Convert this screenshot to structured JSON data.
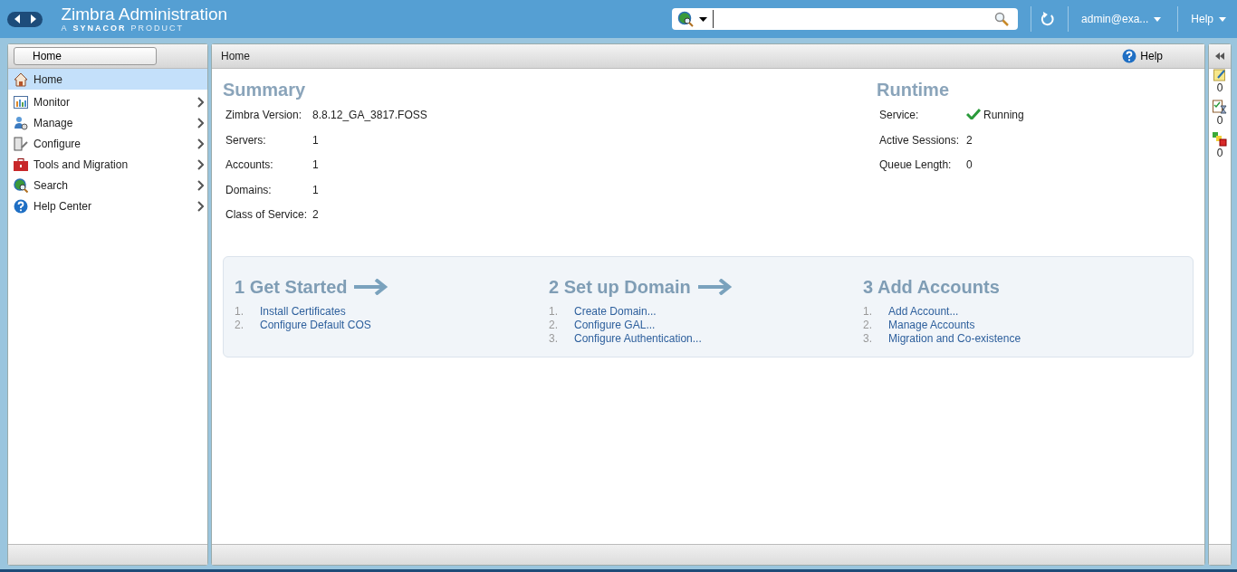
{
  "header": {
    "title": "Zimbra Administration",
    "subtitle_prefix": "A",
    "subtitle_brand": "SYNACOR",
    "subtitle_suffix": "PRODUCT",
    "user": "admin@exa...",
    "help": "Help"
  },
  "sidebar": {
    "breadcrumb": "Home",
    "items": [
      {
        "label": "Home",
        "kind": "home",
        "selected": true,
        "expandable": false
      },
      {
        "label": "Monitor",
        "kind": "monitor",
        "selected": false,
        "expandable": true
      },
      {
        "label": "Manage",
        "kind": "manage",
        "selected": false,
        "expandable": true
      },
      {
        "label": "Configure",
        "kind": "configure",
        "selected": false,
        "expandable": true
      },
      {
        "label": "Tools and Migration",
        "kind": "tools",
        "selected": false,
        "expandable": true
      },
      {
        "label": "Search",
        "kind": "search",
        "selected": false,
        "expandable": true
      },
      {
        "label": "Help Center",
        "kind": "help",
        "selected": false,
        "expandable": true
      }
    ]
  },
  "main": {
    "title": "Home",
    "help": "Help",
    "summary": {
      "heading": "Summary",
      "rows": [
        {
          "label": "Zimbra Version:",
          "value": "8.8.12_GA_3817.FOSS"
        },
        {
          "label": "Servers:",
          "value": "1"
        },
        {
          "label": "Accounts:",
          "value": "1"
        },
        {
          "label": "Domains:",
          "value": "1"
        },
        {
          "label": "Class of Service:",
          "value": "2"
        }
      ]
    },
    "runtime": {
      "heading": "Runtime",
      "rows": [
        {
          "label": "Service:",
          "value": "Running",
          "ok": true
        },
        {
          "label": "Active Sessions:",
          "value": "2",
          "ok": false
        },
        {
          "label": "Queue Length:",
          "value": "0",
          "ok": false
        }
      ]
    },
    "steps": [
      {
        "title": "1 Get Started",
        "arrow": true,
        "links": [
          {
            "num": "1.",
            "text": "Install Certificates"
          },
          {
            "num": "2.",
            "text": "Configure Default COS"
          }
        ]
      },
      {
        "title": "2 Set up Domain",
        "arrow": true,
        "links": [
          {
            "num": "1.",
            "text": "Create Domain..."
          },
          {
            "num": "2.",
            "text": "Configure GAL..."
          },
          {
            "num": "3.",
            "text": "Configure Authentication..."
          }
        ]
      },
      {
        "title": "3 Add Accounts",
        "arrow": false,
        "links": [
          {
            "num": "1.",
            "text": "Add Account..."
          },
          {
            "num": "2.",
            "text": "Manage Accounts"
          },
          {
            "num": "3.",
            "text": "Migration and Co-existence"
          }
        ]
      }
    ]
  },
  "right_panel": {
    "items": [
      {
        "kind": "notes",
        "count": "0"
      },
      {
        "kind": "tasks",
        "count": "0"
      },
      {
        "kind": "status",
        "count": "0"
      }
    ]
  }
}
